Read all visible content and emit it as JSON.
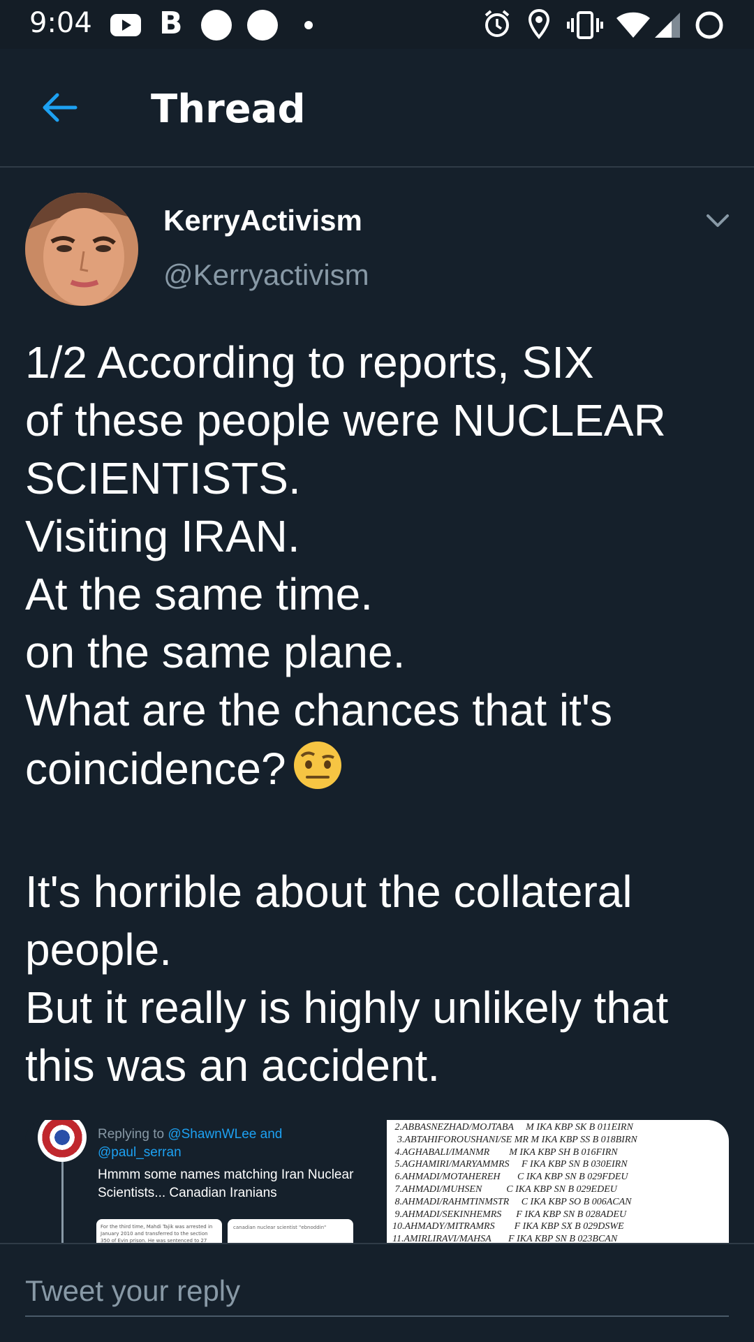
{
  "status_bar": {
    "time": "9:04",
    "notification_letter": "B",
    "icons": [
      "youtube-icon",
      "b-icon",
      "circle-icon",
      "circle-icon",
      "dot-icon",
      "alarm-icon",
      "location-icon",
      "vibrate-icon",
      "wifi-icon",
      "signal-icon",
      "battery-icon"
    ]
  },
  "header": {
    "title": "Thread",
    "back_icon": "arrow-left-icon"
  },
  "tweet": {
    "display_name": "KerryActivism",
    "handle": "@Kerryactivism",
    "lines_1": [
      "1/2 According to reports, SIX",
      "of these people were NUCLEAR",
      "SCIENTISTS.",
      "Visiting IRAN.",
      "At the same time.",
      "on the same plane.",
      "What are the chances that it's",
      "coincidence?"
    ],
    "lines_2": [
      "It's horrible about the collateral",
      "people.",
      "But it really is highly unlikely that",
      "this was an accident."
    ],
    "emoji": "face-with-raised-eyebrow"
  },
  "media": {
    "left": {
      "replying_prefix": "Replying to ",
      "mention_1": "@ShawnWLee and",
      "mention_2": "@paul_serran",
      "body": "Hmmm some names matching Iran Nuclear Scientists... Canadian Iranians",
      "card1_text": "For the third time, Mahdi Tajik was arrested in January 2010 and transferred to the section 350 of Evin prison. He was sentenced to 27",
      "card2_text": "canadian nuclear scientist \"ebnoddin\""
    },
    "right": {
      "rows": [
        " 2.ABBASNEZHAD/MOJTABA     M IKA KBP SK B 011EIRN",
        "  3.ABTAHIFOROUSHANI/SE MR M IKA KBP SS B 018BIRN",
        " 4.AGHABALI/IMANMR        M IKA KBP SH B 016FIRN",
        " 5.AGHAMIRI/MARYAMMRS     F IKA KBP SN B 030EIRN",
        " 6.AHMADI/MOTAHEREH       C IKA KBP SN B 029FDEU",
        " 7.AHMADI/MUHSEN          C IKA KBP SN B 029EDEU",
        " 8.AHMADI/RAHMTINMSTR     C IKA KBP SO B 006ACAN",
        " 9.AHMADI/SEKINHEMRS      F IKA KBP SN B 028ADEU",
        "10.AHMADY/MITRAMRS        F IKA KBP SX B 029DSWE",
        "11.AMIRLIRAVI/MAHSA       F IKA KBP SN B 023BCAN"
      ]
    }
  },
  "reply": {
    "placeholder": "Tweet your reply"
  },
  "colors": {
    "background": "#15202b",
    "accent": "#1da1f2",
    "secondary_text": "#8899a6"
  }
}
